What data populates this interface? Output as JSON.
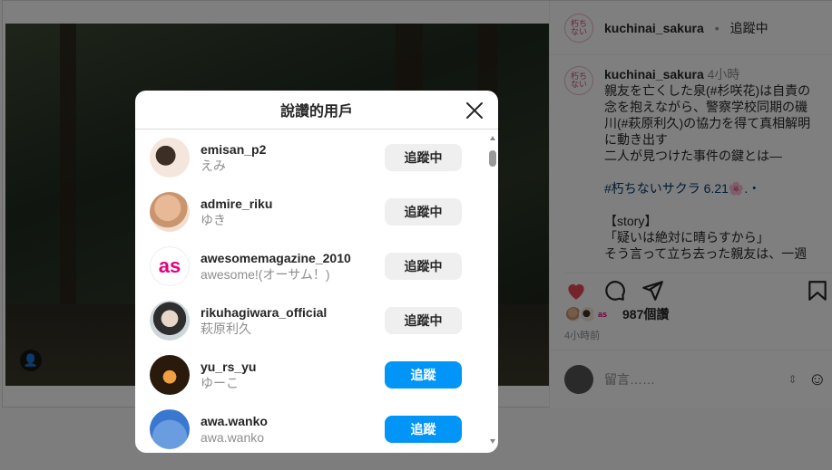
{
  "modal": {
    "title": "說讚的用戶",
    "users": [
      {
        "username": "emisan_p2",
        "fullname": "えみ",
        "button": "追蹤中",
        "state": "following"
      },
      {
        "username": "admire_riku",
        "fullname": "ゆき",
        "button": "追蹤中",
        "state": "following"
      },
      {
        "username": "awesomemagazine_2010",
        "fullname": "awesome!(オーサム！)",
        "button": "追蹤中",
        "state": "following",
        "avatar_text": "as"
      },
      {
        "username": "rikuhagiwara_official",
        "fullname": "萩原利久",
        "button": "追蹤中",
        "state": "following"
      },
      {
        "username": "yu_rs_yu",
        "fullname": "ゆーこ",
        "button": "追蹤",
        "state": "follow"
      },
      {
        "username": "awa.wanko",
        "fullname": "awa.wanko",
        "button": "追蹤",
        "state": "follow"
      }
    ]
  },
  "sidebar": {
    "username": "kuchinai_sakura",
    "separator": "•",
    "follow_label": "追蹤中",
    "caption": {
      "username": "kuchinai_sakura",
      "time": "4小時",
      "lines": [
        "親友を亡くした泉(#杉咲花)は自責の",
        "念を抱えながら、警察学校同期の磯",
        "川(#萩原利久)の協力を得て真相解明",
        "に動き出す",
        "二人が見つけた事件の鍵とは—",
        "",
        "#朽ちないサクラ 6.21🌸.・",
        "",
        "【story】",
        "「疑いは絶対に晴らすから」",
        "そう言って立ち去った親友は、一週"
      ]
    },
    "likes": "987個讚",
    "posted_time": "4小時前",
    "comment_placeholder": "留言……"
  },
  "colors": {
    "follow_button": "#0095f6",
    "following_button": "#efefef",
    "heart": "#ed4956"
  }
}
